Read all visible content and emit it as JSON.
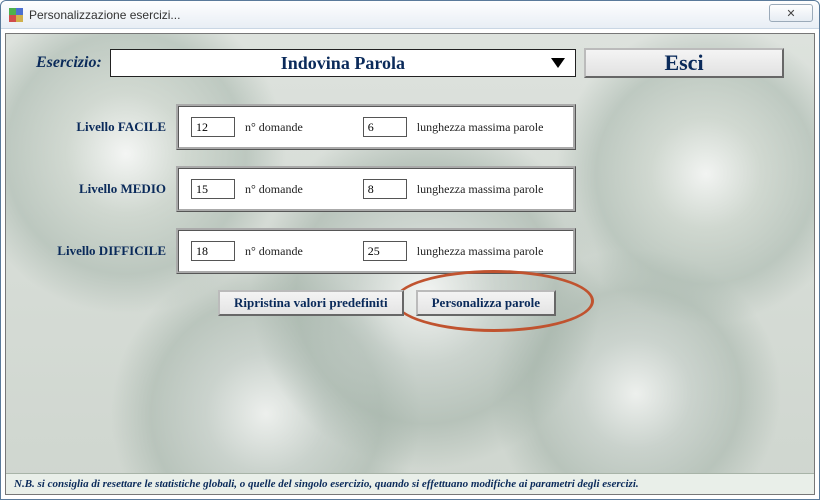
{
  "window": {
    "title": "Personalizzazione esercizi...",
    "close_glyph": "✕"
  },
  "header": {
    "label": "Esercizio:",
    "selected_exercise": "Indovina Parola",
    "exit_label": "Esci"
  },
  "levels": [
    {
      "label": "Livello FACILE",
      "questions": "12",
      "questions_label": "n° domande",
      "maxlen": "6",
      "maxlen_label": "lunghezza massima parole"
    },
    {
      "label": "Livello MEDIO",
      "questions": "15",
      "questions_label": "n° domande",
      "maxlen": "8",
      "maxlen_label": "lunghezza massima parole"
    },
    {
      "label": "Livello DIFFICILE",
      "questions": "18",
      "questions_label": "n° domande",
      "maxlen": "25",
      "maxlen_label": "lunghezza massima parole"
    }
  ],
  "actions": {
    "reset_label": "Ripristina valori predefiniti",
    "customize_label": "Personalizza parole"
  },
  "footer": {
    "note": "N.B. si consiglia di resettare le statistiche globali, o quelle del singolo esercizio, quando si effettuano modifiche ai parametri degli esercizi."
  }
}
